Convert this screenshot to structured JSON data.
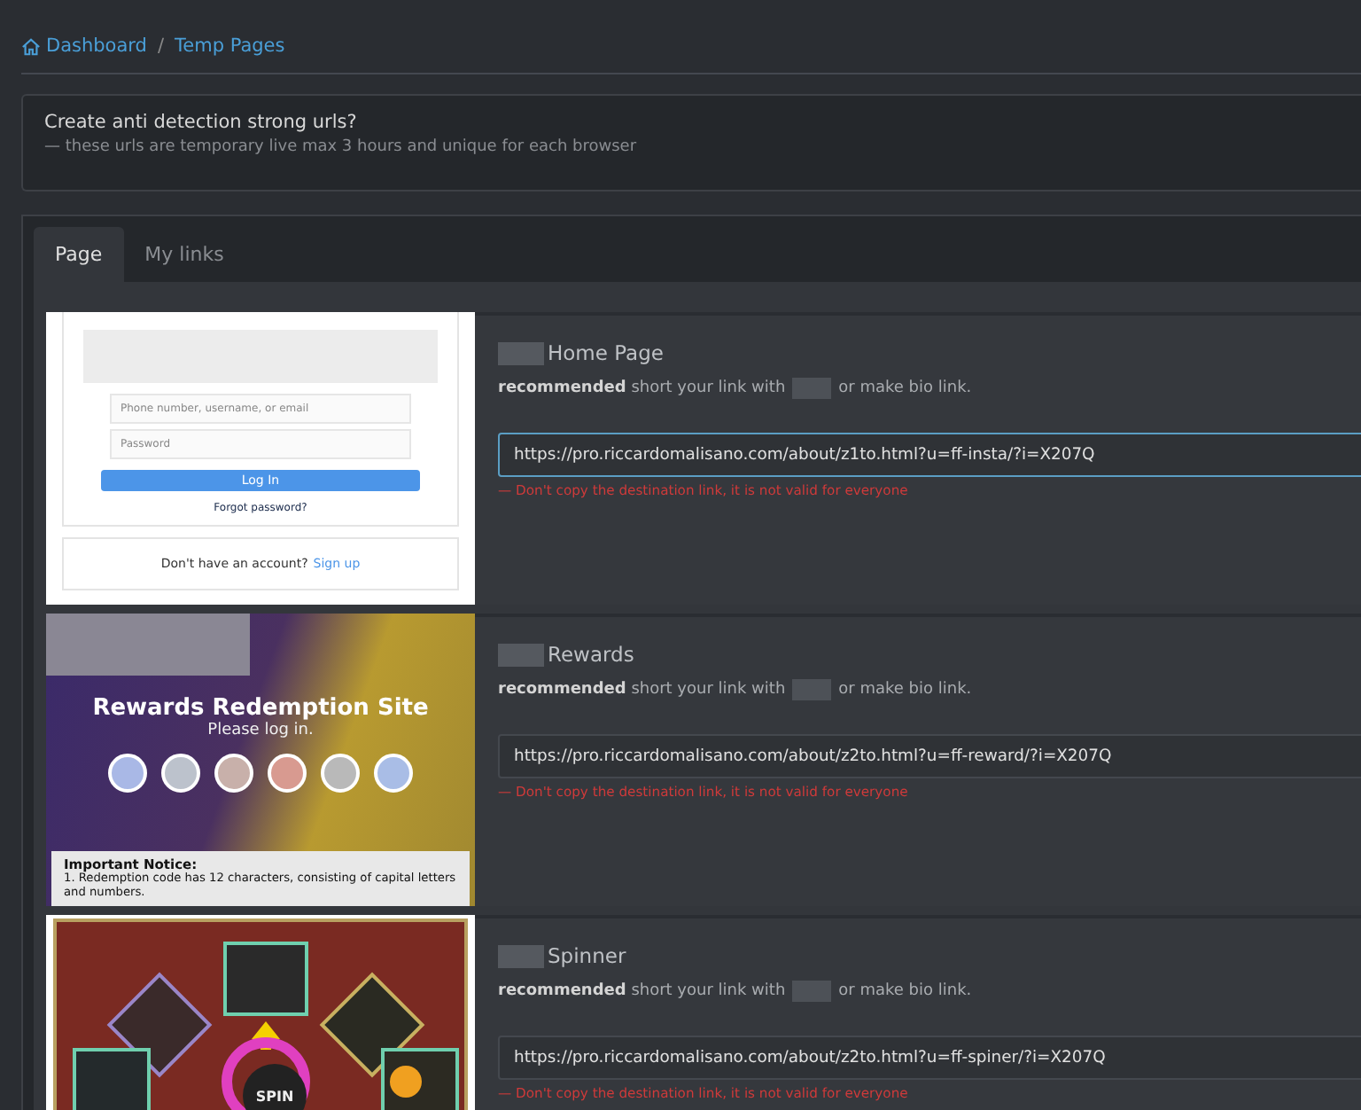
{
  "breadcrumb": {
    "separator": "/",
    "items": [
      {
        "label": "Dashboard",
        "kind": "home"
      },
      {
        "label": "Temp Pages",
        "kind": "page"
      }
    ]
  },
  "notice": {
    "title": "Create anti detection strong urls?",
    "subtitle": "— these urls are temporary live max 3 hours and unique for each browser"
  },
  "tabs": [
    {
      "label": "Page",
      "selected": true
    },
    {
      "label": "My links",
      "selected": false
    }
  ],
  "pages": [
    {
      "kind": "login",
      "preview": {
        "fields": [
          "Phone number, username, or email",
          "Password"
        ],
        "button": "Log In",
        "link": "Forgot password?",
        "signup_text": "Don't have an account?",
        "signup_link": "Sign up"
      },
      "title": "Home Page",
      "hint": "**recommended** short your link with",
      "hint_end": "or make bio link.",
      "url": "https://pro.riccardomalisano.com/about/z1to.html?u=ff-insta/?i=X207Q",
      "focused": true,
      "warning": "— Don't copy the destination link, it is not valid for everyone"
    },
    {
      "kind": "rewards",
      "preview": {
        "heading": "Rewards Redemption Site",
        "subheading": "Please log in.",
        "notice_title": "Important Notice:",
        "notice_text": "1. Redemption code has 12 characters, consisting of capital letters and numbers."
      },
      "title": "Rewards",
      "hint": "**recommended** short your link with",
      "hint_end": "or make bio link.",
      "url": "https://pro.riccardomalisano.com/about/z2to.html?u=ff-reward/?i=X207Q",
      "focused": false,
      "warning": "— Don't copy the destination link, it is not valid for everyone"
    },
    {
      "kind": "spinner",
      "preview": {
        "button": "SPIN"
      },
      "title": "Spinner",
      "hint": "**recommended** short your link with",
      "hint_end": "or make bio link.",
      "url": "https://pro.riccardomalisano.com/about/z2to.html?u=ff-spiner/?i=X207Q",
      "focused": false,
      "warning": "— Don't copy the destination link, it is not valid for everyone"
    }
  ]
}
